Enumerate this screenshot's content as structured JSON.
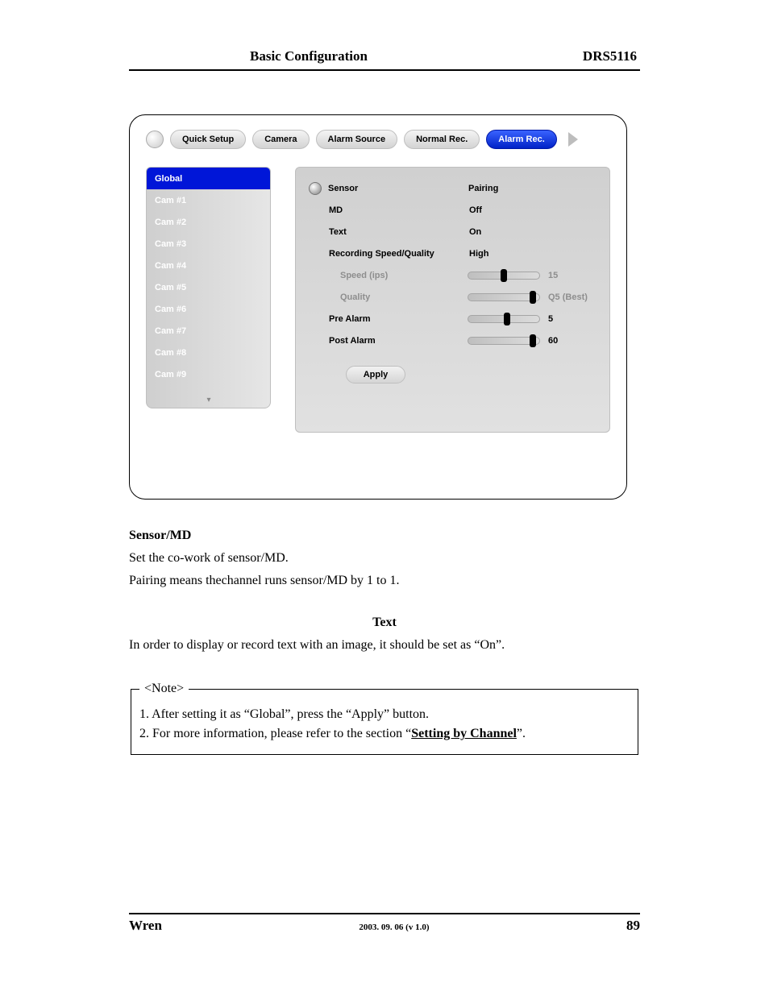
{
  "header": {
    "left": "Basic Configuration",
    "right": "DRS5116"
  },
  "tabs": {
    "items": [
      "Quick Setup",
      "Camera",
      "Alarm Source",
      "Normal Rec.",
      "Alarm Rec."
    ],
    "active_index": 4
  },
  "sidebar": {
    "items": [
      "Global",
      "Cam #1",
      "Cam #2",
      "Cam #3",
      "Cam #4",
      "Cam #5",
      "Cam #6",
      "Cam #7",
      "Cam #8",
      "Cam #9"
    ],
    "selected_index": 0
  },
  "settings": {
    "sensor": {
      "label": "Sensor",
      "value": "Pairing"
    },
    "md": {
      "label": "MD",
      "value": "Off"
    },
    "text": {
      "label": "Text",
      "value": "On"
    },
    "recq": {
      "label": "Recording Speed/Quality",
      "value": "High"
    },
    "speed": {
      "label": "Speed (ips)",
      "value": "15",
      "pos_pct": 50
    },
    "quality": {
      "label": "Quality",
      "value": "Q5 (Best)",
      "pos_pct": 92
    },
    "pre": {
      "label": "Pre Alarm",
      "value": "5",
      "pos_pct": 55
    },
    "post": {
      "label": "Post Alarm",
      "value": "60",
      "pos_pct": 92
    },
    "apply_label": "Apply"
  },
  "doc": {
    "h1": "Sensor/MD",
    "p1": "Set the co-work of sensor/MD.",
    "p2": "Pairing means thechannel runs sensor/MD by 1 to 1.",
    "h2": "Text",
    "p3": "In order to display or record text with an image, it should be set as “On”.",
    "note_legend": "<Note>",
    "note1_a": "1. After setting it as “Global”, press the “Apply” button.",
    "note2_a": "2. For more information, please refer to the section “",
    "note2_link": "Setting by Channel",
    "note2_b": "”."
  },
  "footer": {
    "brand": "Wren",
    "mid": "2003. 09. 06 (v 1.0)",
    "page": "89"
  }
}
